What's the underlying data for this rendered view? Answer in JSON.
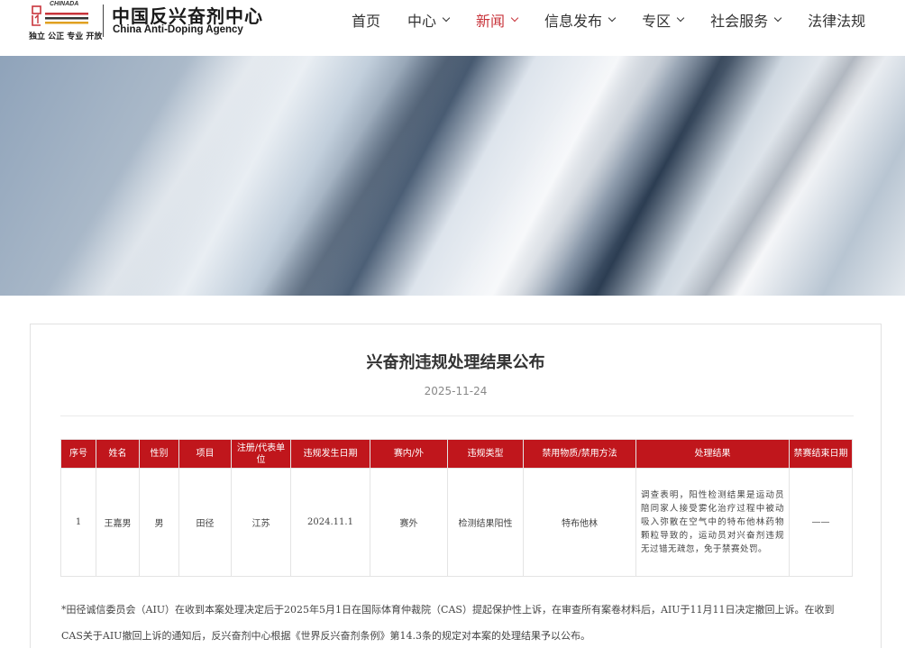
{
  "header": {
    "logo_brand": "CHINADA",
    "logo_tagline": "独立 公正 专业 开放",
    "logo_name_cn": "中国反兴奋剂中心",
    "logo_name_en": "China Anti-Doping Agency"
  },
  "nav": {
    "items": [
      {
        "label": "首页",
        "has_dropdown": false,
        "active": false
      },
      {
        "label": "中心",
        "has_dropdown": true,
        "active": false
      },
      {
        "label": "新闻",
        "has_dropdown": true,
        "active": true
      },
      {
        "label": "信息发布",
        "has_dropdown": true,
        "active": false
      },
      {
        "label": "专区",
        "has_dropdown": true,
        "active": false
      },
      {
        "label": "社会服务",
        "has_dropdown": true,
        "active": false
      },
      {
        "label": "法律法规",
        "has_dropdown": false,
        "active": false
      }
    ]
  },
  "article": {
    "title": "兴奋剂违规处理结果公布",
    "date": "2025-11-24",
    "table": {
      "headers": [
        "序号",
        "姓名",
        "性别",
        "项目",
        "注册/代表单位",
        "违规发生日期",
        "赛内/外",
        "违规类型",
        "禁用物质/禁用方法",
        "处理结果",
        "禁赛结束日期"
      ],
      "rows": [
        [
          "1",
          "王嘉男",
          "男",
          "田径",
          "江苏",
          "2024.11.1",
          "赛外",
          "检测结果阳性",
          "特布他林",
          "调查表明，阳性检测结果是运动员陪同家人接受雾化治疗过程中被动吸入弥散在空气中的特布他林药物颗粒导致的，运动员对兴奋剂违规无过错无疏忽，免于禁赛处罚。",
          "——"
        ]
      ]
    },
    "footnote": "*田径诚信委员会（AIU）在收到本案处理决定后于2025年5月1日在国际体育仲裁院（CAS）提起保护性上诉，在审查所有案卷材料后，AIU于11月11日决定撤回上诉。在收到CAS关于AIU撤回上诉的通知后，反兴奋剂中心根据《世界反兴奋剂条例》第14.3条的规定对本案的处理结果予以公布。"
  },
  "colors": {
    "accent": "#c8343b",
    "table_header": "#c0161c"
  }
}
